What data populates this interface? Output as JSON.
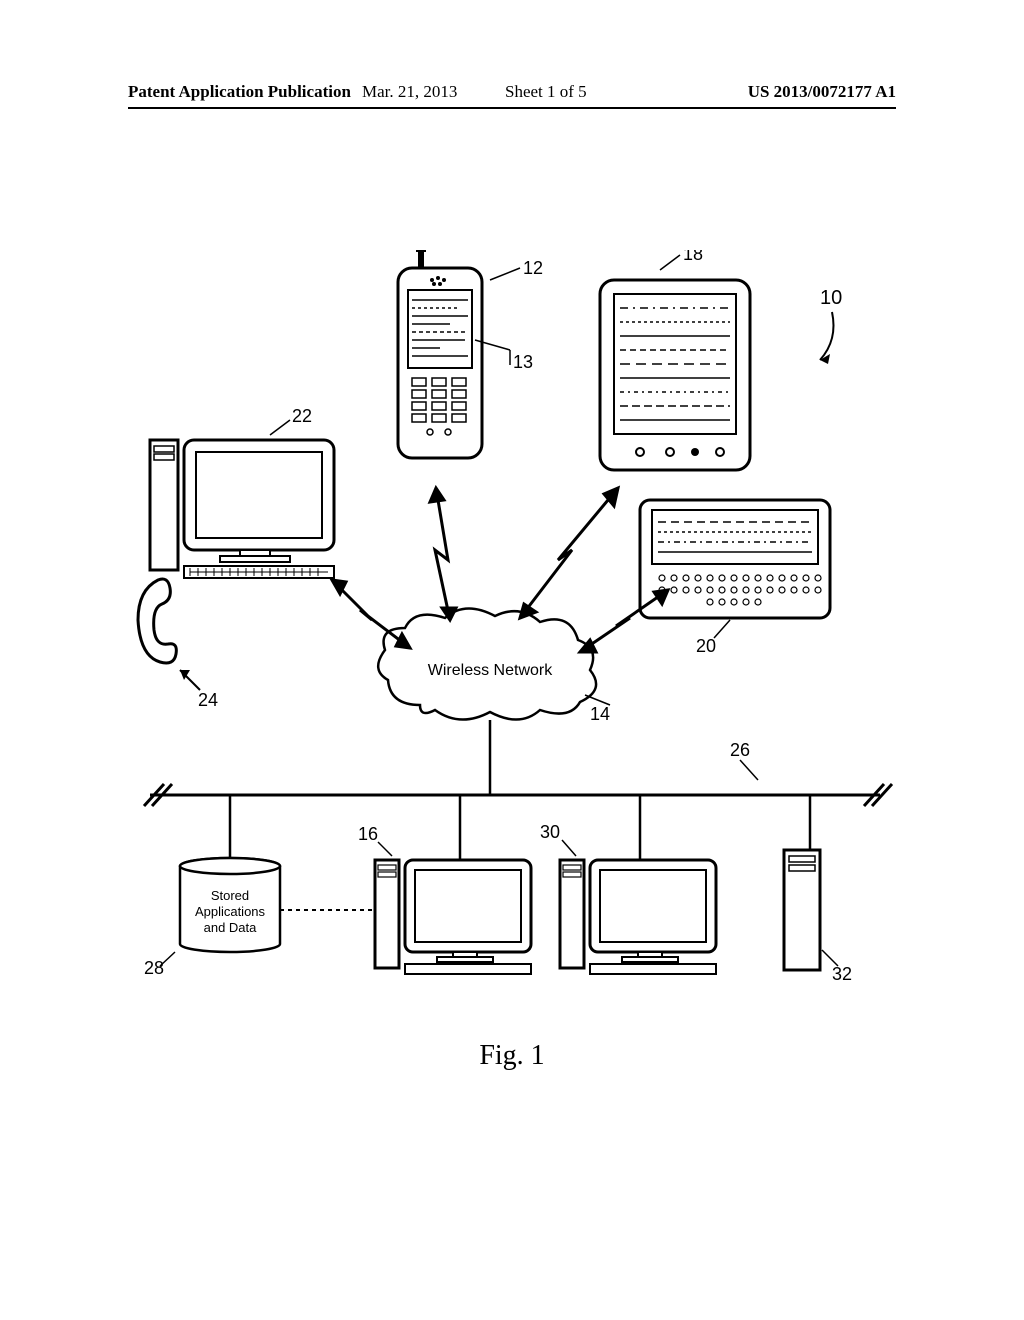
{
  "header": {
    "publication_label": "Patent Application Publication",
    "date": "Mar. 21, 2013",
    "sheet": "Sheet 1 of 5",
    "pub_number": "US 2013/0072177 A1"
  },
  "figure": {
    "caption": "Fig. 1",
    "cloud_label": "Wireless Network",
    "db_label_line1": "Stored",
    "db_label_line2": "Applications",
    "db_label_line3": "and Data",
    "refs": {
      "system": "10",
      "phone": "12",
      "phone_screen": "13",
      "cloud": "14",
      "server1": "16",
      "pda": "18",
      "keyboard_dev": "20",
      "desktop_top": "22",
      "phone_handset": "24",
      "bus": "26",
      "db": "28",
      "server2": "30",
      "tower_right": "32"
    }
  }
}
